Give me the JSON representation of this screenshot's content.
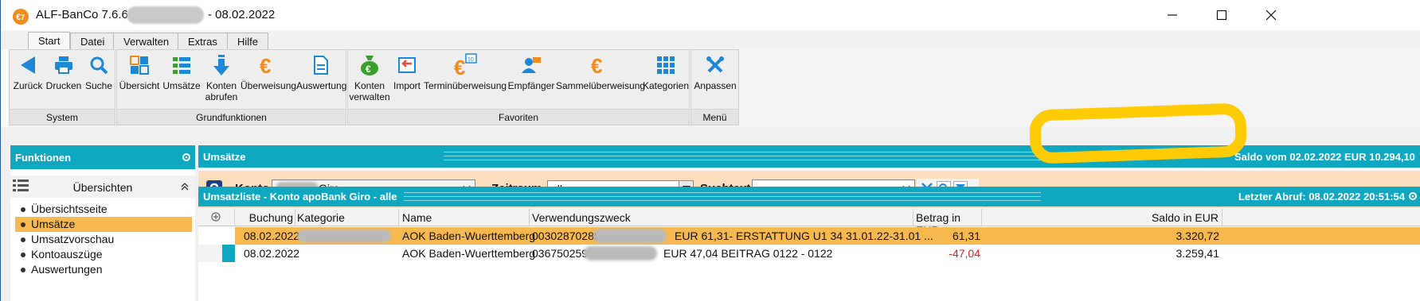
{
  "window": {
    "title": "ALF-BanCo 7.6.6",
    "title_suffix": "-  08.02.2022"
  },
  "ribbon": {
    "tabs": [
      {
        "label": "Start",
        "active": true
      },
      {
        "label": "Datei"
      },
      {
        "label": "Verwalten"
      },
      {
        "label": "Extras"
      },
      {
        "label": "Hilfe"
      }
    ],
    "groups": {
      "system": {
        "label": "System",
        "buttons": [
          {
            "label": "Zurück",
            "icon": "back-arrow-icon"
          },
          {
            "label": "Drucken",
            "icon": "printer-icon"
          },
          {
            "label": "Suche",
            "icon": "search-icon"
          }
        ]
      },
      "grundfunktionen": {
        "label": "Grundfunktionen",
        "buttons": [
          {
            "label": "Übersicht",
            "icon": "overview-icon"
          },
          {
            "label": "Umsätze",
            "icon": "transactions-list-icon"
          },
          {
            "label": "Konten\nabrufen",
            "icon": "download-arrow-icon"
          },
          {
            "label": "Überweisung",
            "icon": "euro-icon"
          },
          {
            "label": "Auswertung",
            "icon": "report-document-icon"
          }
        ]
      },
      "favoriten": {
        "label": "Favoriten",
        "buttons": [
          {
            "label": "Konten\nverwalten",
            "icon": "money-bag-icon"
          },
          {
            "label": "Import",
            "icon": "import-icon"
          },
          {
            "label": "Terminüberweisung",
            "icon": "scheduled-transfer-icon"
          },
          {
            "label": "Empfänger",
            "icon": "recipient-icon"
          },
          {
            "label": "Sammelüberweisung",
            "icon": "collective-transfer-icon"
          },
          {
            "label": "Kategorien",
            "icon": "categories-grid-icon"
          }
        ]
      },
      "menu": {
        "label": "Menü",
        "buttons": [
          {
            "label": "Anpassen",
            "icon": "tools-icon"
          }
        ]
      }
    }
  },
  "sidebar": {
    "header": "Funktionen",
    "section": "Übersichten",
    "items": [
      {
        "label": "Übersichtsseite",
        "active": false
      },
      {
        "label": "Umsätze",
        "active": true
      },
      {
        "label": "Umsatzvorschau",
        "active": false
      },
      {
        "label": "Kontoauszüge",
        "active": false
      },
      {
        "label": "Auswertungen",
        "active": false
      }
    ]
  },
  "umsaetze": {
    "title": "Umsätze",
    "saldo": "Saldo vom 02.02.2022  EUR 10.294,10",
    "filter": {
      "konto_label": "Konto",
      "konto_value": "Giro",
      "zeitraum_label": "Zeitraum",
      "zeitraum_value": "alle",
      "suchtext_label": "Suchtext",
      "suchtext_value": ""
    },
    "list_title": "Umsatzliste - Konto apoBank Giro - alle",
    "last_fetch": "Letzter Abruf: 08.02.2022 20:51:54",
    "columns": [
      "Buchung",
      "Kategorie",
      "Name",
      "Verwendungszweck",
      "Betrag in EUR",
      "Saldo in EUR"
    ],
    "rows": [
      {
        "buchung": "08.02.2022",
        "kategorie": "",
        "name": "AOK Baden-Wuerttemberg",
        "verwendungszweck_prefix": "00302870289",
        "verwendungszweck": "EUR 61,31- ERSTATTUNG U1 34 31.01.22-31.01 ...",
        "betrag": "61,31",
        "saldo": "3.320,72",
        "selected": true,
        "negative": false
      },
      {
        "buchung": "08.02.2022",
        "kategorie": "",
        "name": "AOK Baden-Wuerttemberg",
        "verwendungszweck_prefix": "036750259",
        "verwendungszweck": "EUR 47,04 BEITRAG 0122 - 0122",
        "betrag": "-47,04",
        "saldo": "3.259,41",
        "selected": false,
        "negative": true
      }
    ]
  },
  "colors": {
    "accent": "#0fa8c0",
    "selection": "#f7b850",
    "filter_bg": "#f9ddbd",
    "negative": "#d32020",
    "highlight": "#ffcb05"
  }
}
